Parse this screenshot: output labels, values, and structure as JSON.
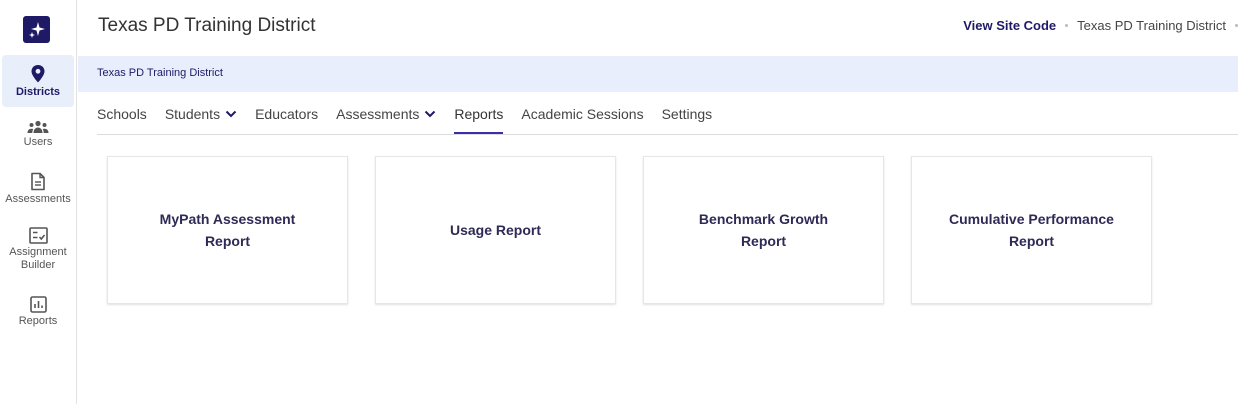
{
  "sidebar": {
    "logo_icon": "sparkle-icon",
    "items": [
      {
        "label": "Districts",
        "icon": "location-pin-icon",
        "active": true
      },
      {
        "label": "Users",
        "icon": "users-icon",
        "active": false
      },
      {
        "label": "Assessments",
        "icon": "document-icon",
        "active": false
      },
      {
        "label": "Assignment Builder",
        "icon": "checklist-icon",
        "active": false
      },
      {
        "label": "Reports",
        "icon": "bar-chart-icon",
        "active": false
      }
    ]
  },
  "header": {
    "title": "Texas PD Training District",
    "site_code_link": "View Site Code",
    "district_name": "Texas PD Training District"
  },
  "breadcrumb": {
    "current": "Texas PD Training District"
  },
  "tabs": [
    {
      "label": "Schools",
      "has_dropdown": false,
      "active": false
    },
    {
      "label": "Students",
      "has_dropdown": true,
      "active": false
    },
    {
      "label": "Educators",
      "has_dropdown": false,
      "active": false
    },
    {
      "label": "Assessments",
      "has_dropdown": true,
      "active": false
    },
    {
      "label": "Reports",
      "has_dropdown": false,
      "active": true
    },
    {
      "label": "Academic Sessions",
      "has_dropdown": false,
      "active": false
    },
    {
      "label": "Settings",
      "has_dropdown": false,
      "active": false
    }
  ],
  "reports": [
    {
      "title": "MyPath Assessment Report"
    },
    {
      "title": "Usage Report"
    },
    {
      "title": "Benchmark Growth Report"
    },
    {
      "title": "Cumulative Performance Report"
    }
  ],
  "colors": {
    "brand": "#1f1a66",
    "accent": "#3b2fa8",
    "breadcrumb_bg": "#e8eefc"
  }
}
